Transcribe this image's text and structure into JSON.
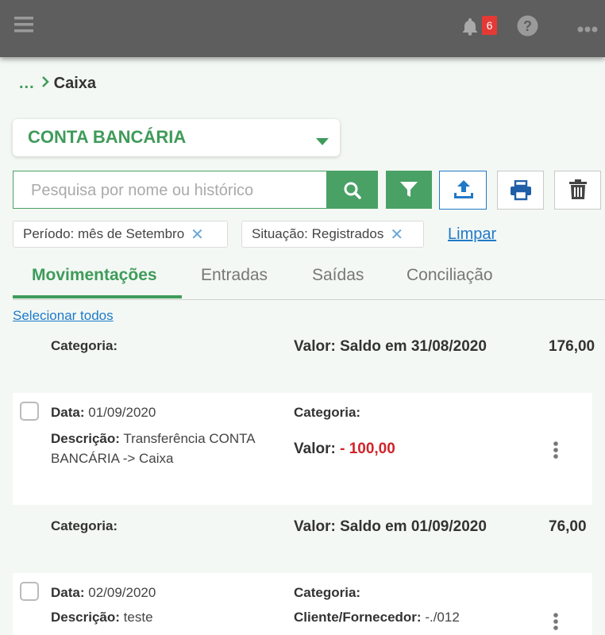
{
  "topbar": {
    "notification_count": "6"
  },
  "breadcrumb": {
    "ellipsis": "...",
    "current": "Caixa"
  },
  "account": {
    "label": "CONTA BANCÁRIA"
  },
  "search": {
    "placeholder": "Pesquisa por nome ou histórico"
  },
  "filters": [
    {
      "label": "Período: mês de Setembro"
    },
    {
      "label": "Situação: Registrados"
    }
  ],
  "clear_label": "Limpar",
  "tabs": [
    "Movimentações",
    "Entradas",
    "Saídas",
    "Conciliação"
  ],
  "select_all": "Selecionar todos",
  "labels": {
    "categoria": "Categoria:",
    "data": "Data:",
    "descricao": "Descrição:",
    "valor": "Valor:",
    "cliente": "Cliente/Fornecedor:"
  },
  "balances": [
    {
      "label": "Valor: Saldo em 31/08/2020",
      "amount": "176,00"
    },
    {
      "label": "Valor: Saldo em 01/09/2020",
      "amount": "76,00"
    }
  ],
  "entries": [
    {
      "date": "01/09/2020",
      "description_line1": "Transferência CONTA",
      "description_line2": "BANCÁRIA -> Caixa",
      "value": "- 100,00"
    },
    {
      "date": "02/09/2020",
      "description": "teste",
      "client": "-./012"
    }
  ],
  "colors": {
    "primary_green": "#4aa166",
    "accent_blue": "#1f7ac9",
    "negative": "#d2232a",
    "topbar": "#5e5e5e"
  }
}
